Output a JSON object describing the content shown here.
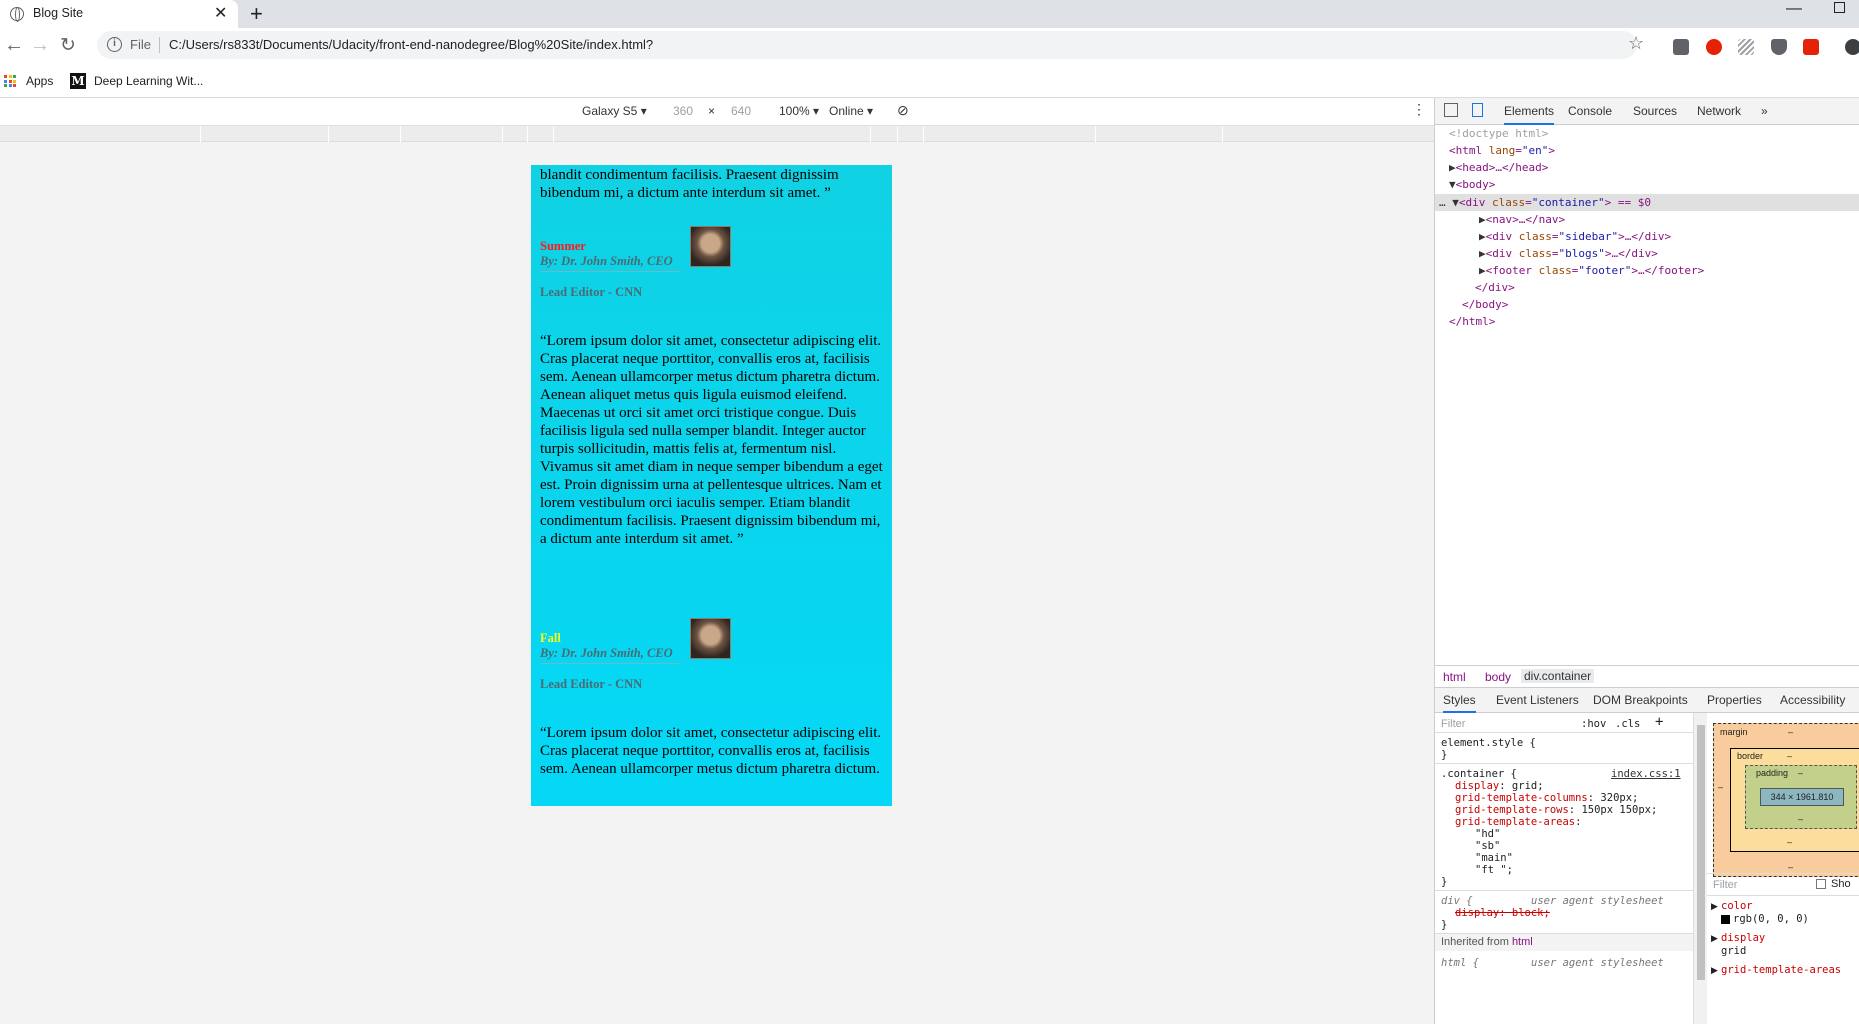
{
  "browser": {
    "tab_title": "Blog Site",
    "tab_close": "✕",
    "new_tab": "+",
    "file_label": "File",
    "url": "C:/Users/rs833t/Documents/Udacity/front-end-nanodegree/Blog%20Site/index.html?",
    "bookmarks": [
      "Apps",
      "Deep Learning Wit..."
    ]
  },
  "device_toolbar": {
    "device": "Galaxy S5 ▾",
    "width": "360",
    "times": "×",
    "height": "640",
    "zoom": "100% ▾",
    "network": "Online ▾"
  },
  "page": {
    "top_para": "blandit condimentum facilisis. Praesent dignissim bibendum mi, a dictum ante interdum sit amet. ”",
    "posts": [
      {
        "season": "Summer",
        "season_color": "#ff1a1a",
        "byline": "By: Dr. John Smith, CEO",
        "role": "Lead Editor - CNN",
        "body": "“Lorem ipsum dolor sit amet, consectetur adipiscing elit. Cras placerat neque porttitor, convallis eros at, facilisis sem. Aenean ullamcorper metus dictum pharetra dictum. Aenean aliquet metus quis ligula euismod eleifend. Maecenas ut orci sit amet orci tristique congue. Duis facilisis ligula sed nulla semper blandit. Integer auctor turpis sollicitudin, mattis felis at, fermentum nisl. Vivamus sit amet diam in neque semper bibendum a eget est. Proin dignissim urna at pellentesque ultrices. Nam et lorem vestibulum orci iaculis semper. Etiam blandit condimentum facilisis. Praesent dignissim bibendum mi, a dictum ante interdum sit amet. ”"
      },
      {
        "season": "Fall",
        "season_color": "#f5ff1a",
        "byline": "By: Dr. John Smith, CEO",
        "role": "Lead Editor - CNN",
        "body": "“Lorem ipsum dolor sit amet, consectetur adipiscing elit. Cras placerat neque porttitor, convallis eros at, facilisis sem. Aenean ullamcorper metus dictum pharetra dictum."
      }
    ]
  },
  "devtools": {
    "tabs": [
      "Elements",
      "Console",
      "Sources",
      "Network",
      "»"
    ],
    "dom": {
      "doctype": "<!doctype html>",
      "html_open_tag": "<html ",
      "html_lang_attr": "lang",
      "html_lang_val": "\"en\"",
      "head": "<head>…</head>",
      "body_open": "<body>",
      "div_tag": "<div ",
      "class_attr": "class",
      "container_val": "\"container\"",
      "eq": "> == $0",
      "nav": "<nav>…</nav>",
      "sidebar_val": "\"sidebar\"",
      "blogs_val": "\"blogs\"",
      "footer_tag": "<footer ",
      "footer_val": "\"footer\"",
      "ellipsis_div_close": ">…</div>",
      "ellipsis_footer_close": ">…</footer>",
      "div_close": "</div>",
      "body_close": "</body>",
      "html_close": "</html>",
      "dots": "…"
    },
    "breadcrumbs": [
      "html",
      "body",
      "div.container"
    ],
    "style_tabs": [
      "Styles",
      "Event Listeners",
      "DOM Breakpoints",
      "Properties",
      "Accessibility"
    ],
    "filter_placeholder": "Filter",
    "hov": ":hov",
    "cls": ".cls",
    "plus": "+",
    "styles": {
      "element_style": "element.style {",
      "close": "}",
      "container_sel": ".container {",
      "container_src": "index.css:1",
      "decls": [
        {
          "prop": "display",
          "val": "grid;"
        },
        {
          "prop": "grid-template-columns",
          "val": "320px;"
        },
        {
          "prop": "grid-template-rows",
          "val": "150px 150px;"
        },
        {
          "prop": "grid-template-areas",
          "val": ""
        }
      ],
      "areas": [
        "\"hd\"",
        "\"sb\"",
        "\"main\"",
        "\"ft \";"
      ],
      "div_sel": "div {",
      "ua": "user agent stylesheet",
      "div_decl": "display: block;",
      "inherited": "Inherited from",
      "inherited_from": "html",
      "html_sel": "html {"
    },
    "box_model": {
      "margin": "margin",
      "border": "border",
      "padding": "padding",
      "dash": "–",
      "content": "344 × 1961.810"
    },
    "computed": {
      "filter": "Filter",
      "show_all": "Sho",
      "props": [
        {
          "name": "color",
          "value": "rgb(0, 0, 0)"
        },
        {
          "name": "display",
          "value": "grid"
        },
        {
          "name": "grid-template-areas",
          "value": ""
        }
      ]
    }
  }
}
